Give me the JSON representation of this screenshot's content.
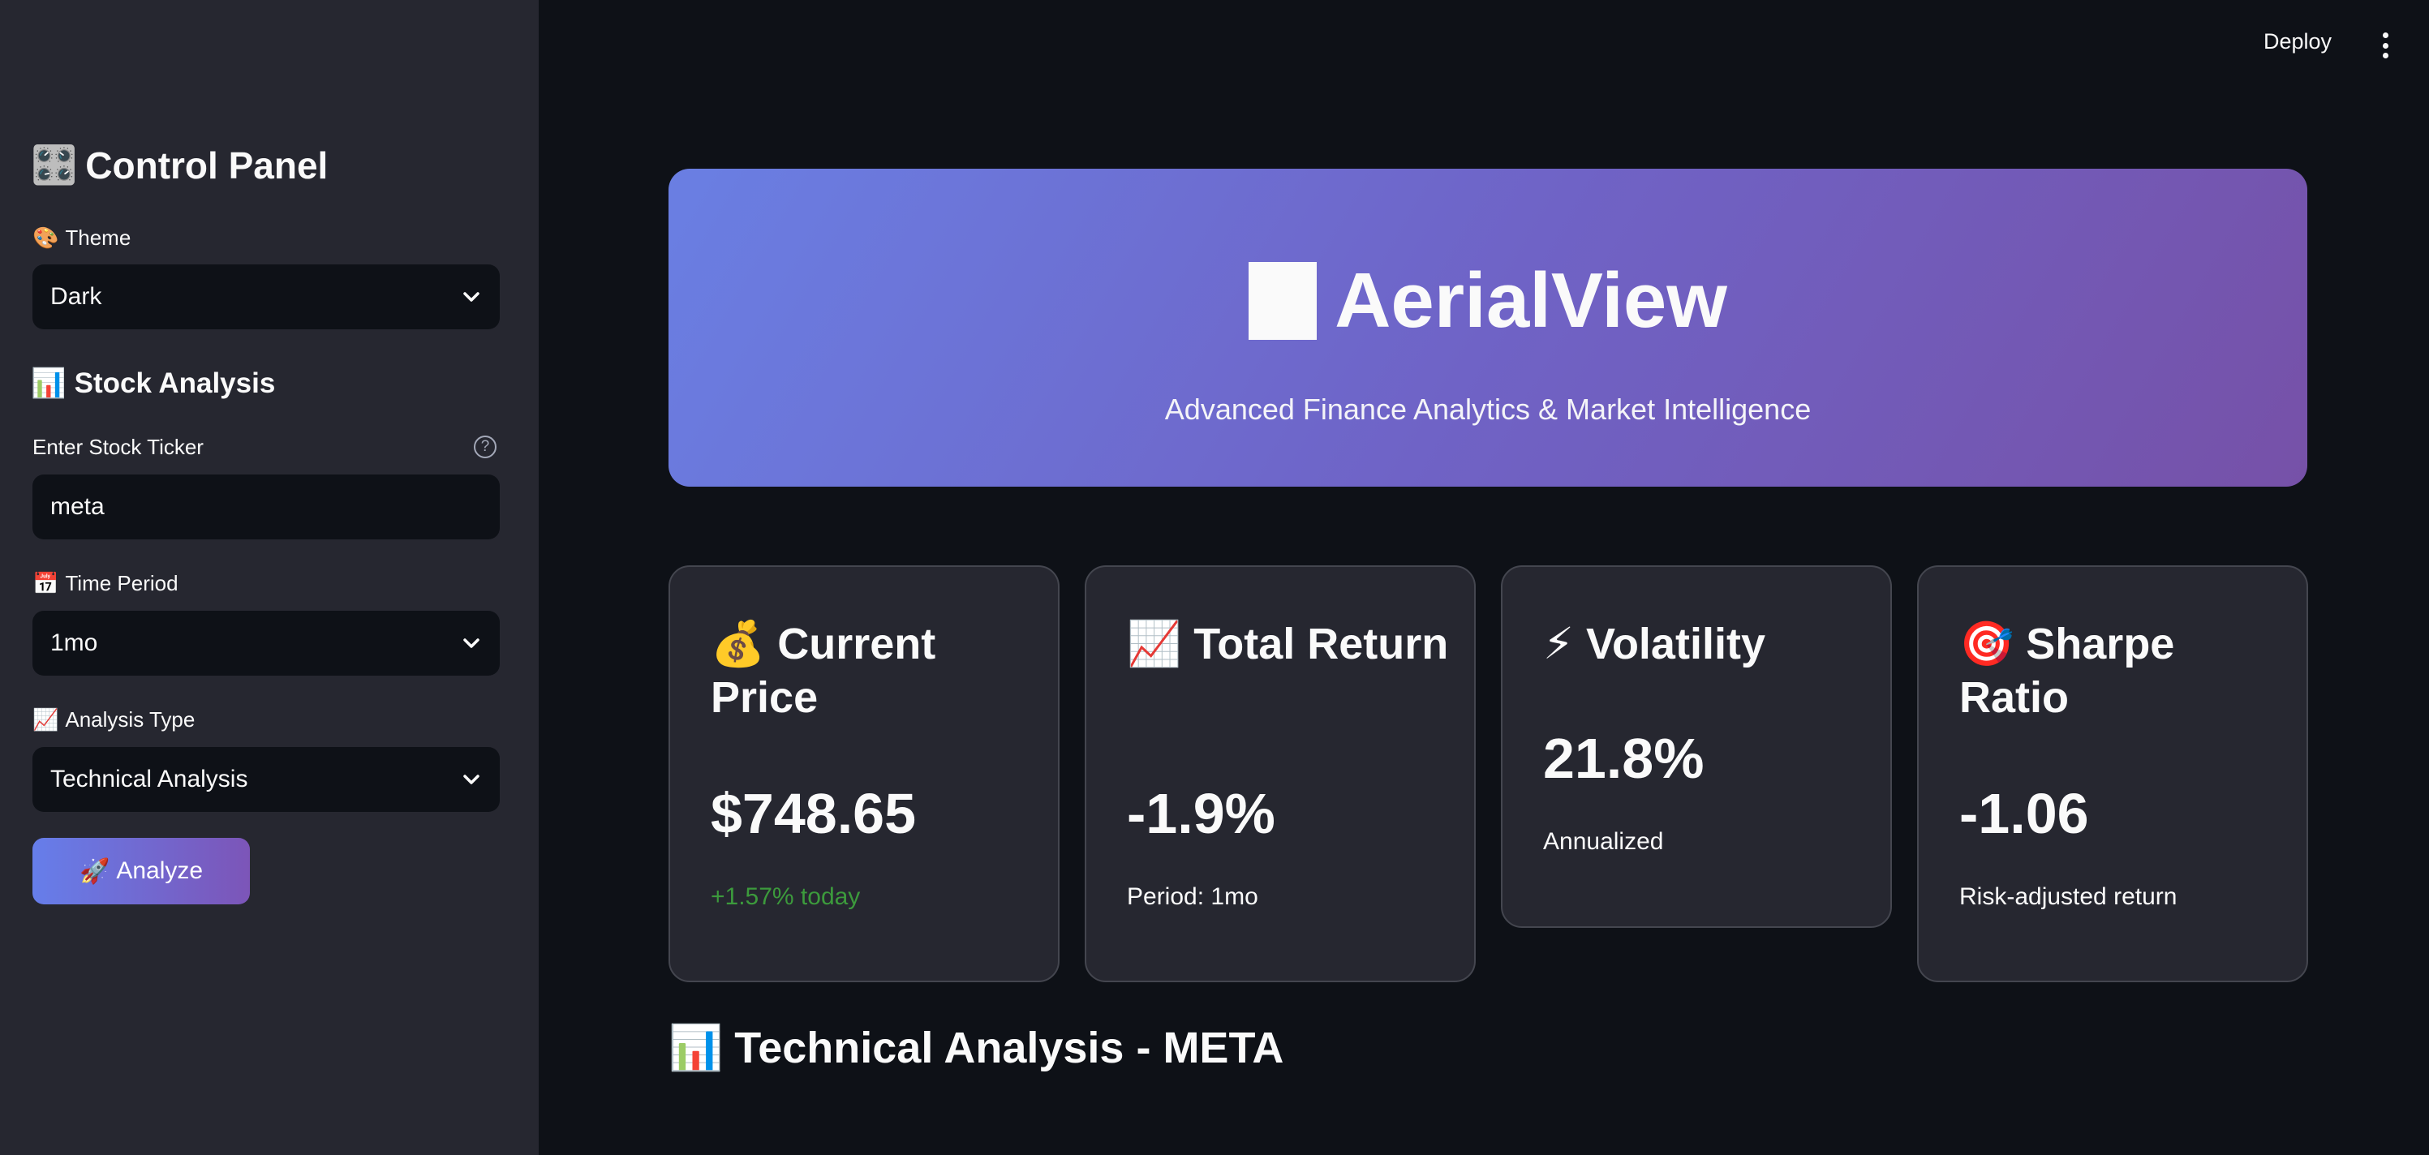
{
  "header": {
    "deploy_label": "Deploy"
  },
  "sidebar": {
    "title_icon": "🎛️",
    "title": "Control Panel",
    "theme": {
      "icon": "🎨",
      "label": "Theme",
      "selected": "Dark"
    },
    "stock_section": {
      "icon": "📊",
      "title": "Stock Analysis"
    },
    "ticker": {
      "label": "Enter Stock Ticker",
      "value": "meta"
    },
    "time_period": {
      "icon": "📅",
      "label": "Time Period",
      "selected": "1mo"
    },
    "analysis_type": {
      "icon": "📈",
      "label": "Analysis Type",
      "selected": "Technical Analysis"
    },
    "analyze_button": {
      "icon": "🚀",
      "label": "Analyze"
    }
  },
  "hero": {
    "title": "AerialView",
    "subtitle": "Advanced Finance Analytics & Market Intelligence"
  },
  "metrics": [
    {
      "icon": "💰",
      "title": "Current Price",
      "value": "$748.65",
      "note": "+1.57% today",
      "note_color": "#3c9a3c"
    },
    {
      "icon": "📈",
      "title": "Total Return",
      "value": "-1.9%",
      "note": "Period: 1mo",
      "note_color": "#fafafa"
    },
    {
      "icon": "⚡",
      "title": "Volatility",
      "value": "21.8%",
      "note": "Annualized",
      "note_color": "#fafafa"
    },
    {
      "icon": "🎯",
      "title": "Sharpe Ratio",
      "value": "-1.06",
      "note": "Risk-adjusted return",
      "note_color": "#fafafa"
    }
  ],
  "section": {
    "icon": "📊",
    "title": "Technical Analysis - META"
  },
  "colors": {
    "background": "#0e1117",
    "sidebar": "#262730",
    "accent_start": "#667eea",
    "accent_end": "#764ba2"
  }
}
